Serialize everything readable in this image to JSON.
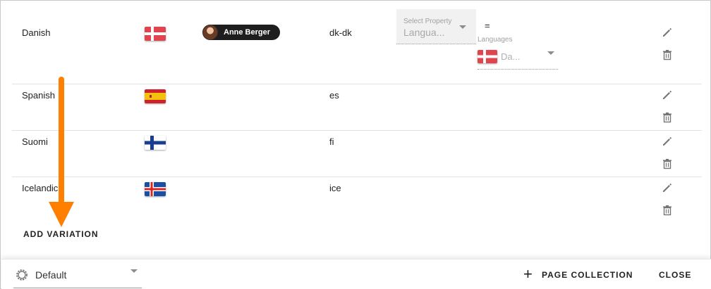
{
  "rows": [
    {
      "name": "Danish",
      "code": "dk-dk",
      "flag": "denmark"
    },
    {
      "name": "Spanish",
      "code": "es",
      "flag": "spain"
    },
    {
      "name": "Suomi",
      "code": "fi",
      "flag": "finland"
    },
    {
      "name": "Icelandic",
      "code": "ice",
      "flag": "iceland"
    }
  ],
  "filter": {
    "user_chip": "Anne Berger",
    "property_label": "Select Property",
    "property_value": "Langua...",
    "operator": "=",
    "languages_label": "Languages",
    "languages_value": "Da..."
  },
  "add_variation": "ADD VARIATION",
  "footer": {
    "default_label": "Default",
    "page_collection": "PAGE COLLECTION",
    "close": "CLOSE"
  },
  "colors": {
    "annotation_arrow": "#ff7f00",
    "chip_bg": "#1e1e1e"
  }
}
